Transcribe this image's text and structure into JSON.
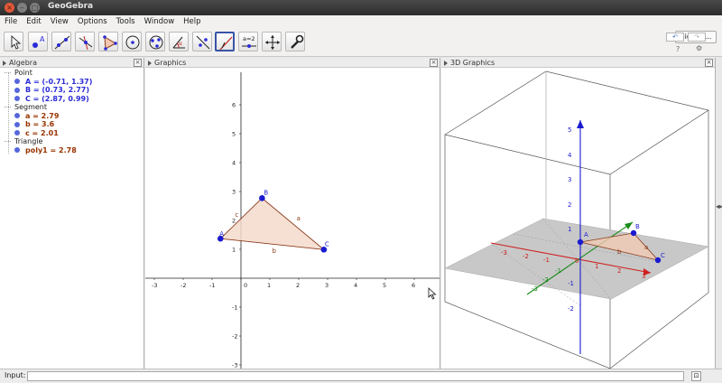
{
  "window": {
    "title": "GeoGebra",
    "close_glyph": "×",
    "min_glyph": "–",
    "max_glyph": "□"
  },
  "menu": [
    "File",
    "Edit",
    "View",
    "Options",
    "Tools",
    "Window",
    "Help"
  ],
  "toolbar": {
    "tools": [
      "move-tool",
      "point-tool",
      "line-tool",
      "perpendicular-tool",
      "polygon-tool",
      "circle-tool",
      "conic-tool",
      "angle-tool",
      "reflect-tool",
      "slider-tool",
      "move-view-tool",
      "settings-tool"
    ],
    "slider_label": "a=2",
    "sign_in_label": "Sign in...",
    "undo_glyph": "↶",
    "redo_glyph": "↷",
    "help_glyph": "?",
    "gear_glyph": "⚙"
  },
  "algebra": {
    "title": "Algebra",
    "close_glyph": "×",
    "categories": [
      {
        "name": "Point",
        "items": [
          {
            "text": "A = (-0.71, 1.37)",
            "color": "#2b2bd8"
          },
          {
            "text": "B = (0.73, 2.77)",
            "color": "#2b2bd8"
          },
          {
            "text": "C = (2.87, 0.99)",
            "color": "#2b2bd8"
          }
        ]
      },
      {
        "name": "Segment",
        "items": [
          {
            "text": "a = 2.79",
            "color": "#993300"
          },
          {
            "text": "b = 3.6",
            "color": "#993300"
          },
          {
            "text": "c = 2.01",
            "color": "#993300"
          }
        ]
      },
      {
        "name": "Triangle",
        "items": [
          {
            "text": "poly1 = 2.78",
            "color": "#993300"
          }
        ]
      }
    ]
  },
  "graphics": {
    "title": "Graphics",
    "close_glyph": "×",
    "x_ticks": [
      "-3",
      "-2",
      "-1",
      "0",
      "1",
      "2",
      "3",
      "4",
      "5",
      "6"
    ],
    "y_ticks": [
      "6",
      "5",
      "4",
      "3",
      "2",
      "1",
      "-1",
      "-2",
      "-3"
    ],
    "points": [
      {
        "label": "A",
        "x": -0.71,
        "y": 1.37
      },
      {
        "label": "B",
        "x": 0.73,
        "y": 2.77
      },
      {
        "label": "C",
        "x": 2.87,
        "y": 0.99
      }
    ],
    "segment_labels": [
      "a",
      "b",
      "c"
    ]
  },
  "graphics3d": {
    "title": "3D Graphics",
    "close_glyph": "×",
    "z_ticks": [
      "5",
      "4",
      "3",
      "2",
      "1",
      "-1",
      "-2"
    ],
    "x_ticks": [
      "-3",
      "-2",
      "-1",
      "0",
      "1",
      "2",
      "3"
    ],
    "y_ticks": [
      "-3",
      "-2",
      "-1"
    ],
    "point_labels": [
      "A",
      "B",
      "C"
    ],
    "segment_labels": [
      "a",
      "b"
    ]
  },
  "inputbar": {
    "label": "Input:",
    "value": "",
    "help_glyph": "⊡"
  },
  "edge_glyph": "◂▸"
}
